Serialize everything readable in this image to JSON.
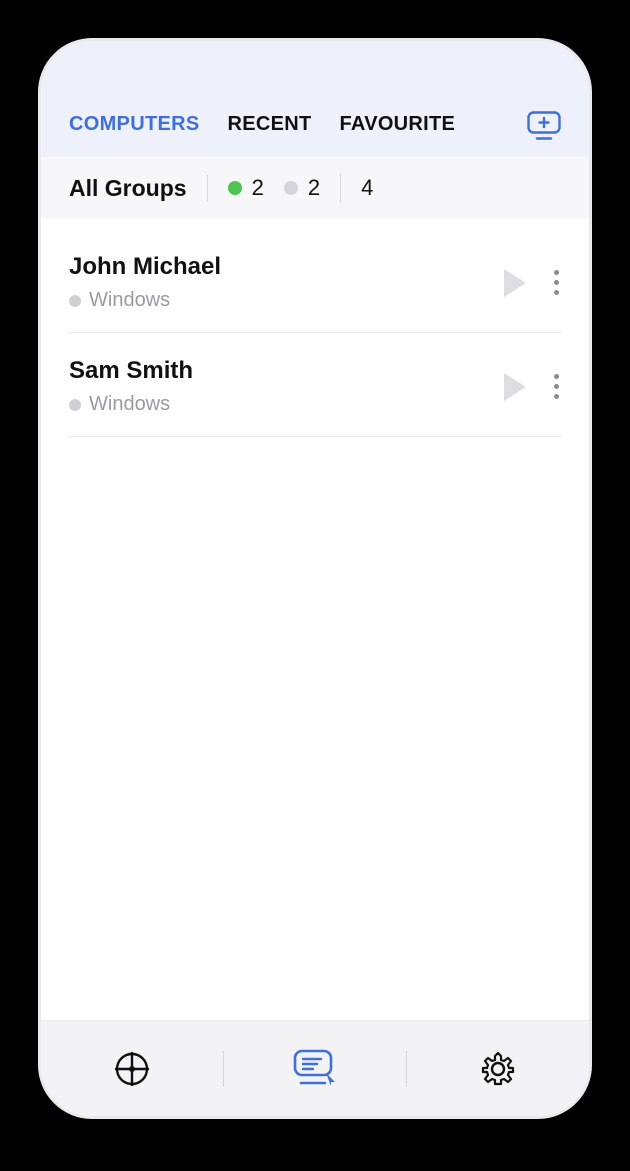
{
  "colors": {
    "accent": "#3f6fd8",
    "online": "#4fc44f",
    "muted": "#d6d6da"
  },
  "tabs": {
    "computers": "COMPUTERS",
    "recent": "RECENT",
    "favourite": "FAVOURITE",
    "active": "computers"
  },
  "groupBar": {
    "title": "All Groups",
    "online": 2,
    "offline": 2,
    "total": 4
  },
  "devices": [
    {
      "name": "John Michael",
      "os": "Windows"
    },
    {
      "name": "Sam Smith",
      "os": "Windows"
    }
  ],
  "icons": {
    "add_monitor": "plus-monitor-icon",
    "nav_target": "crosshair-icon",
    "nav_remote": "remote-screen-icon",
    "nav_settings": "gear-icon"
  }
}
